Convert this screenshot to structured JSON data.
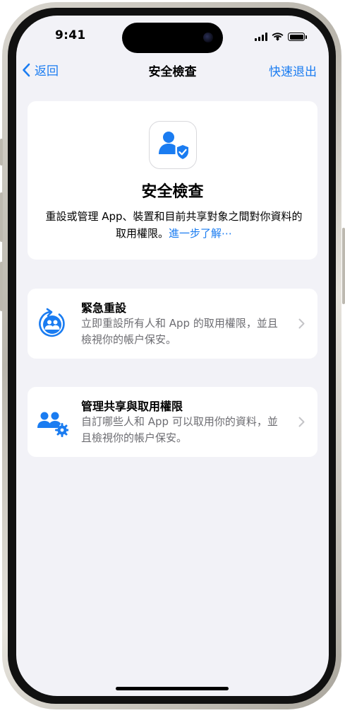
{
  "status_bar": {
    "time": "9:41",
    "icons": [
      "cellular-signal-icon",
      "wifi-icon",
      "battery-icon"
    ]
  },
  "nav": {
    "back_label": "返回",
    "title": "安全檢查",
    "quick_exit_label": "快速退出"
  },
  "header": {
    "icon": "person-shield-icon",
    "title": "安全檢查",
    "description": "重設或管理 App、裝置和目前共享對象之間對你資料的取用權限。",
    "learn_more": "進一步了解⋯"
  },
  "options": [
    {
      "icon": "emergency-reset-icon",
      "title": "緊急重設",
      "description": "立即重設所有人和 App 的取用權限，並且檢視你的帳户保安。"
    },
    {
      "icon": "manage-sharing-icon",
      "title": "管理共享與取用權限",
      "description": "自訂哪些人和 App 可以取用你的資料，並且檢視你的帳户保安。"
    }
  ],
  "colors": {
    "accent": "#1a7cf1",
    "background": "#f2f2f7",
    "card": "#ffffff",
    "secondary_text": "#6d6d72",
    "chevron": "#c4c4c7"
  }
}
